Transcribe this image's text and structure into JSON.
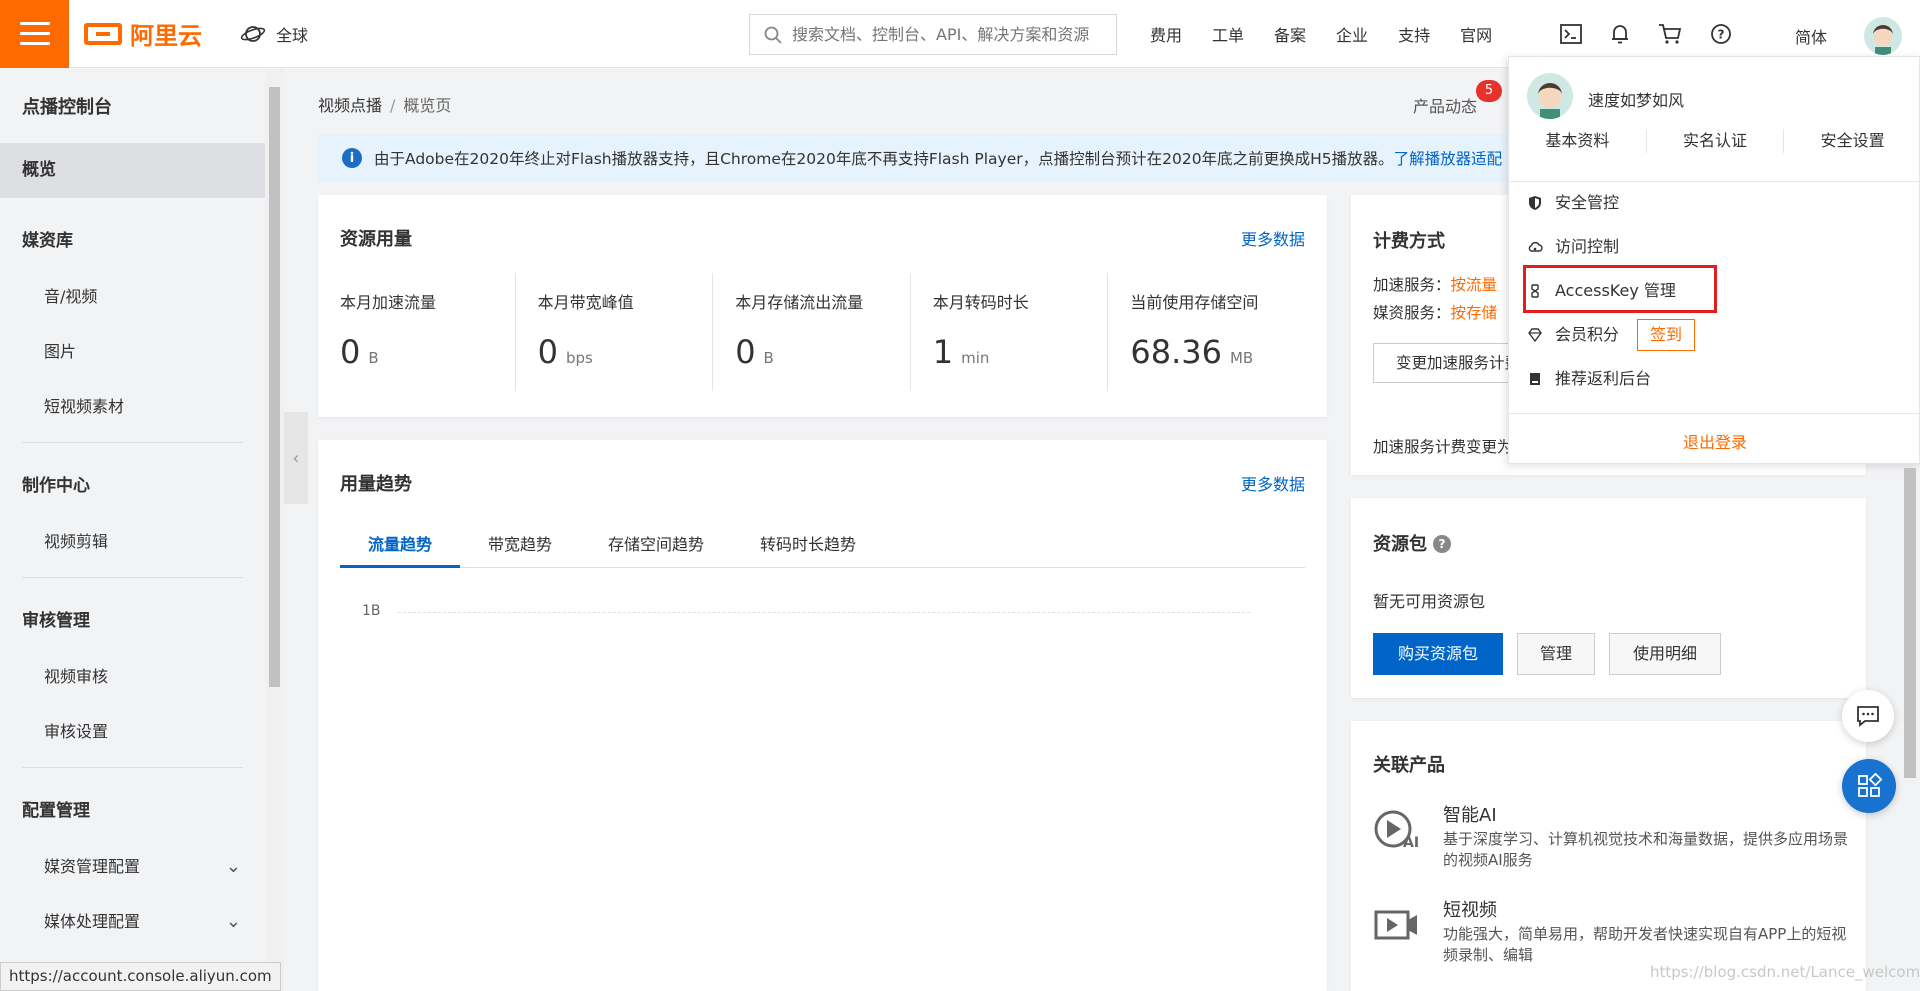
{
  "topbar": {
    "logo_text": "阿里云",
    "region": "全球",
    "search_placeholder": "搜索文档、控制台、API、解决方案和资源",
    "nav": [
      "费用",
      "工单",
      "备案",
      "企业",
      "支持",
      "官网"
    ],
    "lang": "简体"
  },
  "sidebar": {
    "title": "点播控制台",
    "active_item": "概览",
    "sections": [
      {
        "label": "媒资库",
        "items": [
          "音/视频",
          "图片",
          "短视频素材"
        ]
      },
      {
        "label": "制作中心",
        "items": [
          "视频剪辑"
        ]
      },
      {
        "label": "审核管理",
        "items": [
          "视频审核",
          "审核设置"
        ]
      },
      {
        "label": "配置管理",
        "items": [
          "媒资管理配置",
          "媒体处理配置"
        ]
      }
    ]
  },
  "status_url": "https://account.console.aliyun.com",
  "breadcrumb": {
    "root": "视频点播",
    "current": "概览页"
  },
  "product_news": {
    "label": "产品动态",
    "count": "5"
  },
  "notice": {
    "text": "由于Adobe在2020年终止对Flash播放器支持，且Chrome在2020年底不再支持Flash Player，点播控制台预计在2020年底之前更换成H5播放器。",
    "link": "了解播放器适配"
  },
  "usage": {
    "title": "资源用量",
    "more": "更多数据",
    "metrics": [
      {
        "label": "本月加速流量",
        "value": "0",
        "unit": "B"
      },
      {
        "label": "本月带宽峰值",
        "value": "0",
        "unit": "bps"
      },
      {
        "label": "本月存储流出流量",
        "value": "0",
        "unit": "B"
      },
      {
        "label": "本月转码时长",
        "value": "1",
        "unit": "min"
      },
      {
        "label": "当前使用存储空间",
        "value": "68.36",
        "unit": "MB"
      }
    ]
  },
  "trend": {
    "title": "用量趋势",
    "more": "更多数据",
    "tabs": [
      "流量趋势",
      "带宽趋势",
      "存储空间趋势",
      "转码时长趋势"
    ],
    "axis_label": "1B"
  },
  "billing": {
    "title": "计费方式",
    "rows": [
      {
        "label": "加速服务：",
        "value": "按流量"
      },
      {
        "label": "媒资服务：",
        "value": "按存储"
      }
    ],
    "change_button": "变更加速服务计费方式",
    "footer": "加速服务计费变更为"
  },
  "package": {
    "title": "资源包",
    "help": "?",
    "empty": "暂无可用资源包",
    "buy": "购买资源包",
    "manage": "管理",
    "details": "使用明细"
  },
  "related": {
    "title": "关联产品",
    "items": [
      {
        "name": "智能AI",
        "desc": "基于深度学习、计算机视觉技术和海量数据，提供多应用场景的视频AI服务",
        "icon": "ai-play-icon"
      },
      {
        "name": "短视频",
        "desc": "功能强大，简单易用，帮助开发者快速实现自有APP上的短视频录制、编辑",
        "icon": "short-video-icon"
      }
    ]
  },
  "dropdown": {
    "username": "速度如梦如风",
    "links": [
      "基本资料",
      "实名认证",
      "安全设置"
    ],
    "items": [
      {
        "label": "安全管控",
        "icon": "shield-icon"
      },
      {
        "label": "访问控制",
        "icon": "cloud-icon"
      },
      {
        "label": "AccessKey 管理",
        "icon": "key-icon"
      },
      {
        "label": "会员积分",
        "icon": "diamond-icon"
      },
      {
        "label": "推荐返利后台",
        "icon": "book-icon"
      }
    ],
    "signin": "签到",
    "logout": "退出登录"
  },
  "watermark": "https://blog.csdn.net/Lance_welcome",
  "colors": {
    "brand": "#ff6a00",
    "link": "#0064c8",
    "highlight": "#e0201f"
  }
}
